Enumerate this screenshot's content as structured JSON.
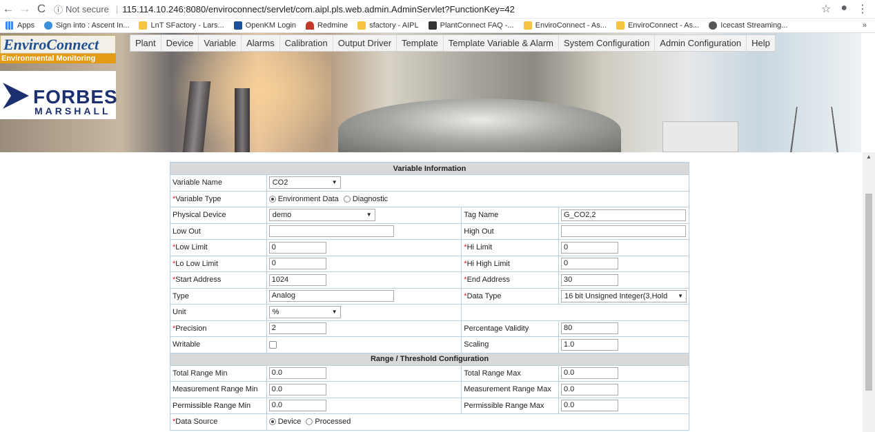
{
  "browser": {
    "url_info": "Not secure",
    "url": "115.114.10.246:8080/enviroconnect/servlet/com.aipl.pls.web.admin.AdminServlet?FunctionKey=42",
    "bookmarks": [
      "Apps",
      "Sign into : Ascent In...",
      "LnT SFactory - Lars...",
      "OpenKM Login",
      "Redmine",
      "sfactory - AIPL",
      "PlantConnect FAQ -...",
      "EnviroConnect - As...",
      "EnviroConnect - As...",
      "Icecast Streaming..."
    ],
    "bookmarks_more": "»"
  },
  "logo": {
    "title": "EnviroConnect",
    "subtitle": "Environmental Monitoring",
    "brand1": "FORBES",
    "brand2": "MARSHALL"
  },
  "menu": [
    "Plant",
    "Device",
    "Variable",
    "Alarms",
    "Calibration",
    "Output Driver",
    "Template",
    "Template Variable & Alarm",
    "System Configuration",
    "Admin Configuration",
    "Help"
  ],
  "form": {
    "section1": "Variable Information",
    "variable_name_label": "Variable Name",
    "variable_name_value": "CO2",
    "variable_type_label": "Variable Type",
    "variable_type_opt1": "Environment Data",
    "variable_type_opt2": "Diagnostic",
    "physical_device_label": "Physical Device",
    "physical_device_value": "demo",
    "tag_name_label": "Tag Name",
    "tag_name_value": "G_CO2,2",
    "low_out_label": "Low Out",
    "low_out_value": "",
    "high_out_label": "High Out",
    "high_out_value": "",
    "low_limit_label": "Low Limit",
    "low_limit_value": "0",
    "hi_limit_label": "Hi Limit",
    "hi_limit_value": "0",
    "lo_low_limit_label": "Lo Low Limit",
    "lo_low_limit_value": "0",
    "hi_high_limit_label": "Hi High Limit",
    "hi_high_limit_value": "0",
    "start_address_label": "Start Address",
    "start_address_value": "1024",
    "end_address_label": "End Address",
    "end_address_value": "30",
    "type_label": "Type",
    "type_value": "Analog",
    "data_type_label": "Data Type",
    "data_type_value": "16 bit Unsigned Integer(3,Hold",
    "unit_label": "Unit",
    "unit_value": "%",
    "precision_label": "Precision",
    "precision_value": "2",
    "percentage_validity_label": "Percentage Validity",
    "percentage_validity_value": "80",
    "writable_label": "Writable",
    "scaling_label": "Scaling",
    "scaling_value": "1.0",
    "section2": "Range / Threshold Configuration",
    "total_range_min_label": "Total Range Min",
    "total_range_min_value": "0.0",
    "total_range_max_label": "Total Range Max",
    "total_range_max_value": "0.0",
    "measurement_range_min_label": "Measurement Range Min",
    "measurement_range_min_value": "0.0",
    "measurement_range_max_label": "Measurement Range Max",
    "measurement_range_max_value": "0.0",
    "permissible_range_min_label": "Permissible Range Min",
    "permissible_range_min_value": "0.0",
    "permissible_range_max_label": "Permissible Range Max",
    "permissible_range_max_value": "0.0",
    "data_source_label": "Data Source",
    "data_source_opt1": "Device",
    "data_source_opt2": "Processed"
  },
  "required_marker": "*"
}
